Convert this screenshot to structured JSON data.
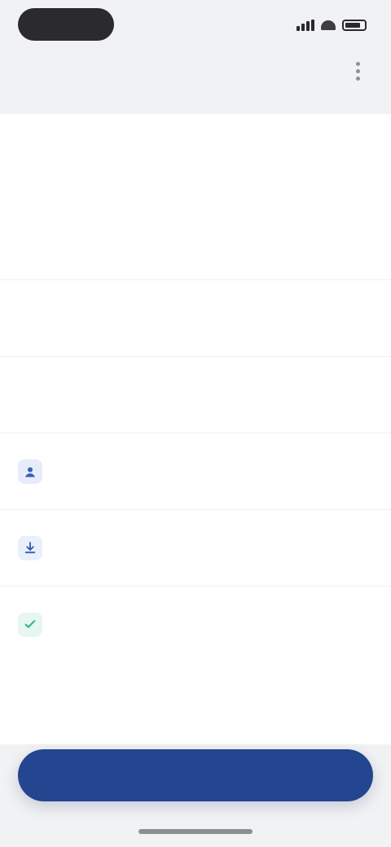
{
  "status": {
    "time": "",
    "signal_bars": 4
  },
  "header": {
    "title": "",
    "menu_icon": "more-vertical-icon"
  },
  "section": {
    "title": "",
    "link": ""
  },
  "fields": [
    {
      "label": "",
      "value": ""
    },
    {
      "label": "",
      "value": ""
    },
    {
      "label": "",
      "value": ""
    }
  ],
  "list": [
    {
      "icon": "user-icon",
      "icon_color": "#3b5fb8",
      "title": "",
      "subtitle": "",
      "right": ""
    },
    {
      "icon": "download-icon",
      "icon_color": "#2f5bb3",
      "title": "",
      "subtitle": "",
      "right": ""
    },
    {
      "icon": "check-icon",
      "icon_color": "#36b28a",
      "title": "",
      "subtitle": "",
      "right": ""
    }
  ],
  "footer": {
    "left": "",
    "right": ""
  },
  "cta": {
    "label": ""
  },
  "colors": {
    "primary": "#24458f",
    "link": "#2b4ea2",
    "bg_header": "#f1f2f4"
  }
}
